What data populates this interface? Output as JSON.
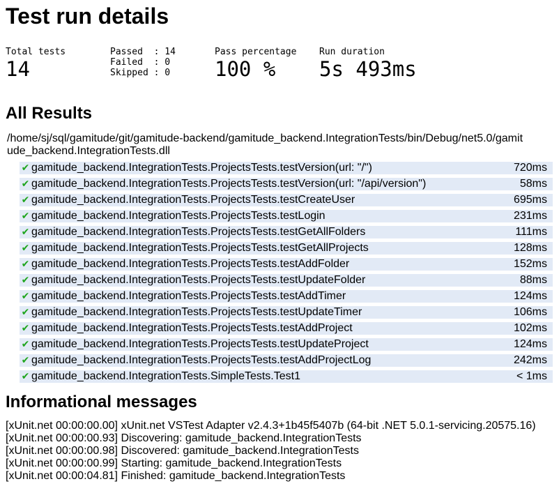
{
  "header": {
    "title": "Test run details"
  },
  "summary": {
    "total_label": "Total tests",
    "total_value": "14",
    "passed_line": "Passed  : 14",
    "failed_line": "Failed  : 0",
    "skipped_line": "Skipped : 0",
    "pass_pct_label": "Pass percentage",
    "pass_pct_value": "100 %",
    "duration_label": "Run duration",
    "duration_value": "5s 493ms"
  },
  "results": {
    "title": "All Results",
    "dll_path": "/home/sj/sql/gamitude/git/gamitude-backend/gamitude_backend.IntegrationTests/bin/Debug/net5.0/gamitude_backend.IntegrationTests.dll",
    "status_icon": "checkmark-icon",
    "pass_color": "#1fa51f",
    "row_color": "#e2eaf6",
    "tests": [
      {
        "name": "gamitude_backend.IntegrationTests.ProjectsTests.testVersion(url: \"/\")",
        "time": "720ms"
      },
      {
        "name": "gamitude_backend.IntegrationTests.ProjectsTests.testVersion(url: \"/api/version\")",
        "time": "58ms"
      },
      {
        "name": "gamitude_backend.IntegrationTests.ProjectsTests.testCreateUser",
        "time": "695ms"
      },
      {
        "name": "gamitude_backend.IntegrationTests.ProjectsTests.testLogin",
        "time": "231ms"
      },
      {
        "name": "gamitude_backend.IntegrationTests.ProjectsTests.testGetAllFolders",
        "time": "111ms"
      },
      {
        "name": "gamitude_backend.IntegrationTests.ProjectsTests.testGetAllProjects",
        "time": "128ms"
      },
      {
        "name": "gamitude_backend.IntegrationTests.ProjectsTests.testAddFolder",
        "time": "152ms"
      },
      {
        "name": "gamitude_backend.IntegrationTests.ProjectsTests.testUpdateFolder",
        "time": "88ms"
      },
      {
        "name": "gamitude_backend.IntegrationTests.ProjectsTests.testAddTimer",
        "time": "124ms"
      },
      {
        "name": "gamitude_backend.IntegrationTests.ProjectsTests.testUpdateTimer",
        "time": "106ms"
      },
      {
        "name": "gamitude_backend.IntegrationTests.ProjectsTests.testAddProject",
        "time": "102ms"
      },
      {
        "name": "gamitude_backend.IntegrationTests.ProjectsTests.testUpdateProject",
        "time": "124ms"
      },
      {
        "name": "gamitude_backend.IntegrationTests.ProjectsTests.testAddProjectLog",
        "time": "242ms"
      },
      {
        "name": "gamitude_backend.IntegrationTests.SimpleTests.Test1",
        "time": "< 1ms"
      }
    ]
  },
  "info": {
    "title": "Informational messages",
    "messages": [
      "[xUnit.net 00:00:00.00] xUnit.net VSTest Adapter v2.4.3+1b45f5407b (64-bit .NET 5.0.1-servicing.20575.16)",
      "[xUnit.net 00:00:00.93] Discovering: gamitude_backend.IntegrationTests",
      "[xUnit.net 00:00:00.98] Discovered: gamitude_backend.IntegrationTests",
      "[xUnit.net 00:00:00.99] Starting: gamitude_backend.IntegrationTests",
      "[xUnit.net 00:00:04.81] Finished: gamitude_backend.IntegrationTests"
    ]
  }
}
